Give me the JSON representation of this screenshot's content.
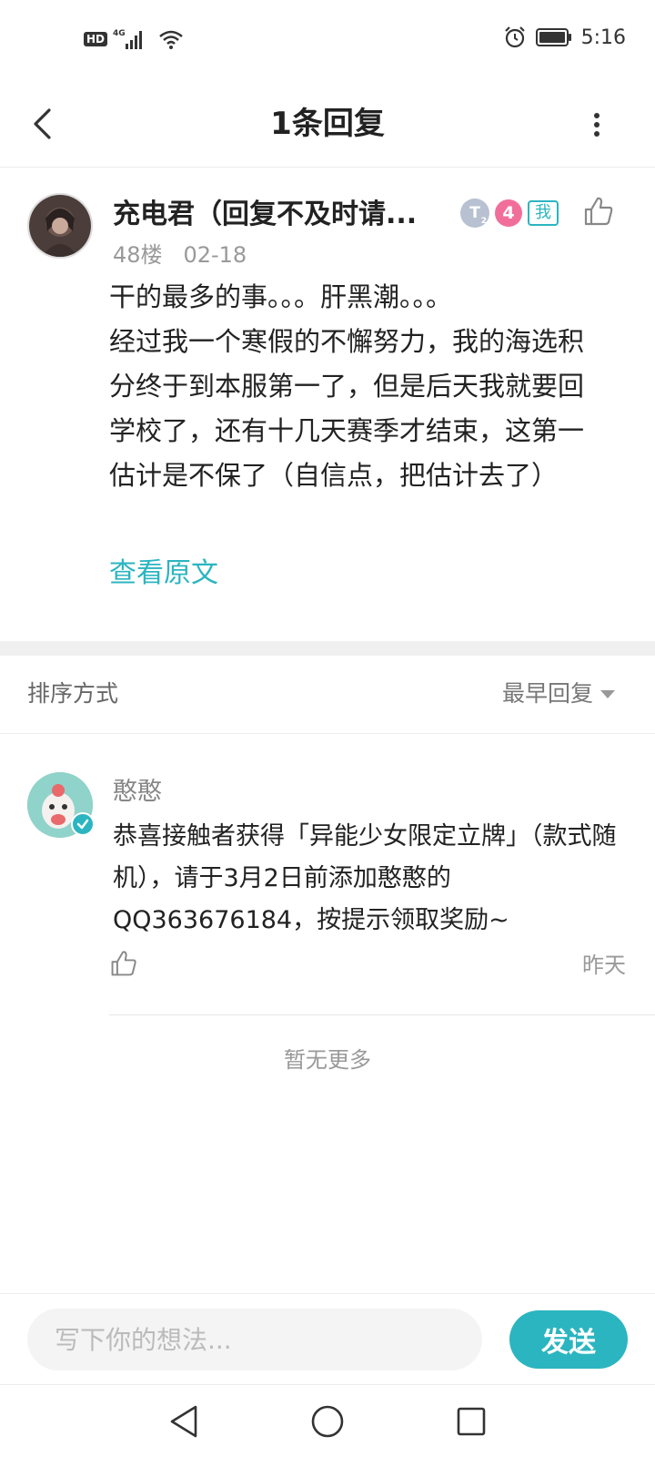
{
  "status_bar": {
    "hd": "HD",
    "network": "4G",
    "time": "5:16",
    "icons": [
      "hd-icon",
      "signal-icon",
      "wifi-icon",
      "alarm-icon",
      "battery-icon"
    ]
  },
  "nav": {
    "title": "1条回复",
    "back_icon": "chevron-left-icon",
    "more_icon": "more-vertical-icon"
  },
  "post": {
    "author": "充电君（回复不及时请...",
    "badge_t": "T",
    "badge_t_sub": "2",
    "badge_level": "4",
    "badge_me": "我",
    "floor": "48楼",
    "date": "02-18",
    "body_lines": [
      "干的最多的事。。。肝黑潮。。。",
      "经过我一个寒假的不懈努力，我的海选积分终于到本服第一了，但是后天我就要回学校了，还有十几天赛季才结束，这第一估计是不保了（自信点，把估计去了）"
    ],
    "view_original": "查看原文"
  },
  "sort": {
    "label": "排序方式",
    "selected": "最早回复"
  },
  "reply": {
    "author": "憨憨",
    "body": "恭喜接触者获得「异能少女限定立牌」（款式随机），请于3月2日前添加憨憨的QQ363676184，按提示领取奖励~",
    "time": "昨天"
  },
  "footer_note": "暂无更多",
  "composer": {
    "placeholder": "写下你的想法...",
    "send_label": "发送"
  },
  "colors": {
    "accent": "#2bb5c0",
    "level_badge": "#f26e9a",
    "muted_text": "#999999"
  }
}
